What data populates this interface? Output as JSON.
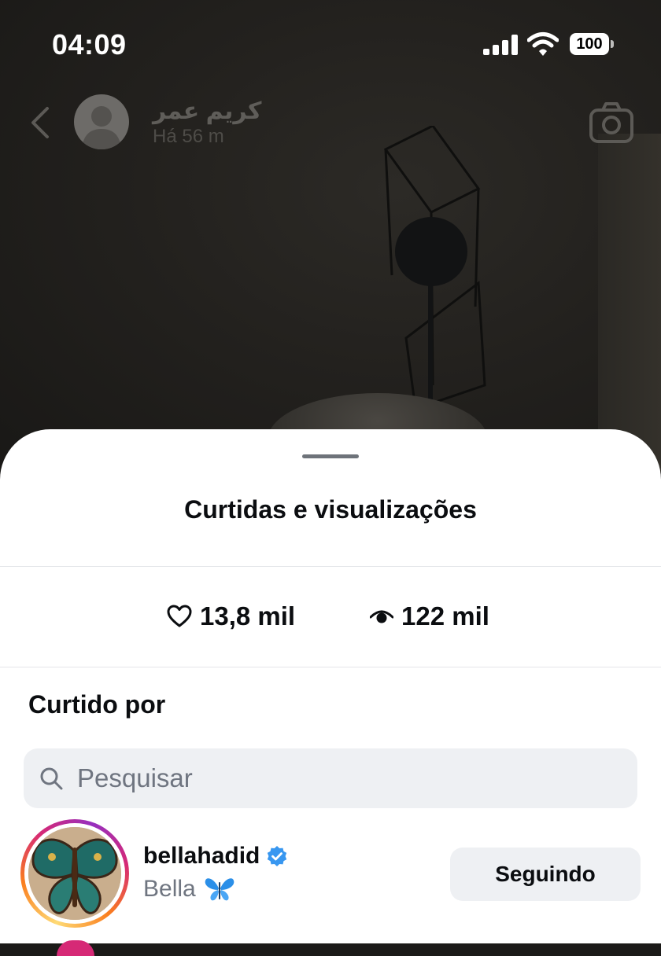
{
  "status_bar": {
    "time": "04:09",
    "battery": "100"
  },
  "story_header": {
    "username": "كريم عمر",
    "time_ago": "Há 56 m"
  },
  "sheet": {
    "title": "Curtidas e visualizações",
    "likes": "13,8 mil",
    "views": "122 mil",
    "section_title": "Curtido por",
    "search_placeholder": "Pesquisar"
  },
  "liked_by": [
    {
      "username": "bellahadid",
      "verified": true,
      "full_name": "Bella",
      "button": "Seguindo"
    }
  ],
  "icons": {
    "back": "chevron-left-icon",
    "camera": "camera-icon",
    "like": "heart-icon",
    "views": "eye-icon",
    "search": "search-icon",
    "verified": "verified-badge-icon",
    "butterfly": "butterfly-emoji"
  },
  "colors": {
    "verified": "#3897f0",
    "sheet_bg": "#ffffff",
    "button_bg": "#eef0f3"
  }
}
